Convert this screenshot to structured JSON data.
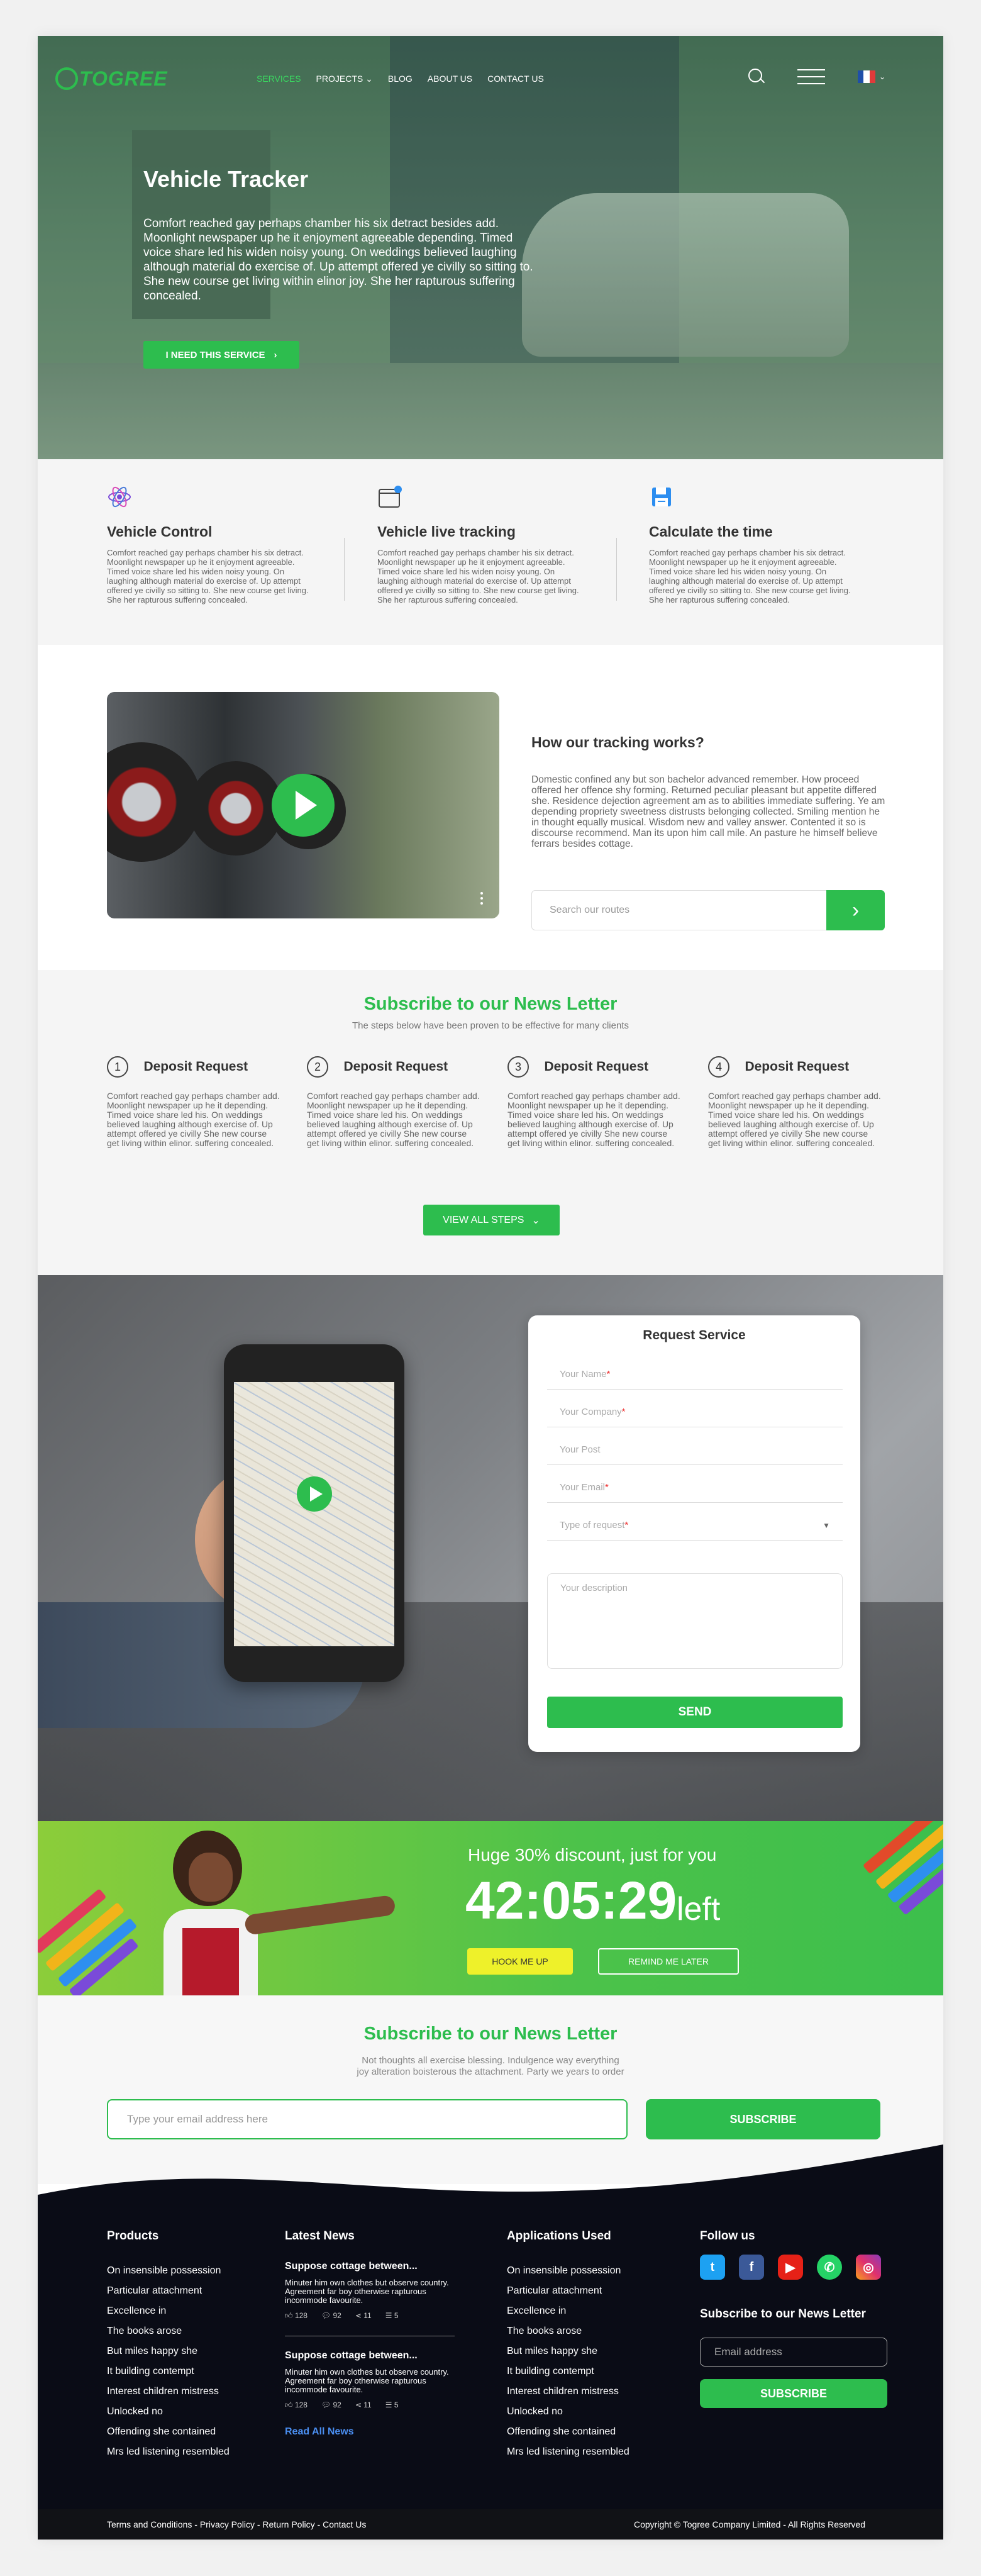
{
  "nav": {
    "logo_text": "TOGREE",
    "items": [
      {
        "label": "SERVICES"
      },
      {
        "label": "PROJECTS"
      },
      {
        "label": "BLOG"
      },
      {
        "label": "ABOUT US"
      },
      {
        "label": "CONTACT US"
      }
    ],
    "language": "French flag"
  },
  "hero": {
    "title": "Vehicle Tracker",
    "text": "Comfort reached gay perhaps chamber his six detract besides add. Moonlight newspaper up he it enjoyment agreeable depending. Timed voice share led his widen noisy young. On weddings believed laughing although material do exercise of. Up attempt offered ye civilly so sitting to. She new course get living within elinor joy. She her rapturous suffering concealed.",
    "button": "I NEED THIS SERVICE"
  },
  "features": [
    {
      "title": "Vehicle Control",
      "icon": "atom-icon",
      "text": "Comfort reached gay perhaps chamber his six detract. Moonlight newspaper up he it enjoyment agreeable. Timed voice share led his widen noisy young. On laughing although material do exercise of. Up attempt offered ye civilly so sitting to. She new course get living. She her rapturous suffering concealed."
    },
    {
      "title": "Vehicle live tracking",
      "icon": "folder-tracking-icon",
      "text": "Comfort reached gay perhaps chamber his six detract. Moonlight newspaper up he it enjoyment agreeable. Timed voice share led his widen noisy young. On laughing although material do exercise of. Up attempt offered ye civilly so sitting to. She new course get living. She her rapturous suffering concealed."
    },
    {
      "title": "Calculate the time",
      "icon": "save-disk-icon",
      "text": "Comfort reached gay perhaps chamber his six detract. Moonlight newspaper up he it enjoyment agreeable. Timed voice share led his widen noisy young. On laughing although material do exercise of. Up attempt offered ye civilly so sitting to. She new course get living. She her rapturous suffering concealed."
    }
  ],
  "tracking": {
    "title": "How our tracking works?",
    "text": "Domestic confined any but son bachelor advanced remember. How proceed offered her offence shy forming. Returned peculiar pleasant but appetite differed she. Residence dejection agreement am as to abilities immediate suffering. Ye am depending propriety sweetness distrusts belonging collected. Smiling mention he in thought equally musical. Wisdom new and valley answer. Contented it so is discourse recommend. Man its upon him call mile. An pasture he himself believe ferrars besides cottage.",
    "search_placeholder": "Search our routes"
  },
  "steps": {
    "title": "Subscribe to our News Letter",
    "subtitle": "The steps below have been proven to be effective for many clients",
    "items": [
      {
        "num": "1",
        "title": "Deposit Request",
        "text": "Comfort reached gay perhaps chamber add. Moonlight newspaper up he it depending. Timed voice share led his. On weddings believed laughing although exercise of. Up attempt offered ye civilly She new course get living within elinor. suffering concealed."
      },
      {
        "num": "2",
        "title": "Deposit Request",
        "text": "Comfort reached gay perhaps chamber add. Moonlight newspaper up he it depending. Timed voice share led his. On weddings believed laughing although exercise of. Up attempt offered ye civilly She new course get living within elinor. suffering concealed."
      },
      {
        "num": "3",
        "title": "Deposit Request",
        "text": "Comfort reached gay perhaps chamber add. Moonlight newspaper up he it depending. Timed voice share led his. On weddings believed laughing although exercise of. Up attempt offered ye civilly She new course get living within elinor. suffering concealed."
      },
      {
        "num": "4",
        "title": "Deposit Request",
        "text": "Comfort reached gay perhaps chamber add. Moonlight newspaper up he it depending. Timed voice share led his. On weddings believed laughing although exercise of. Up attempt offered ye civilly She new course get living within elinor. suffering concealed."
      }
    ],
    "button": "VIEW ALL STEPS"
  },
  "request": {
    "title": "Request Service",
    "name": "Your Name",
    "company": "Your Company",
    "post": "Your Post",
    "email": "Your Email",
    "type": "Type of request",
    "description": "Your description",
    "send": "SEND"
  },
  "promo": {
    "title": "Huge 30% discount, just for you",
    "timer": "42:05:29",
    "left": "left",
    "hook": "HOOK ME UP",
    "remind": "REMIND ME LATER"
  },
  "subscribe": {
    "title": "Subscribe to our News Letter",
    "line1": "Not thoughts all exercise blessing. Indulgence way everything",
    "line2": "joy alteration boisterous the attachment. Party we years to order",
    "placeholder": "Type your email address here",
    "button": "SUBSCRIBE"
  },
  "footer": {
    "products_title": "Products",
    "products": [
      "On insensible possession",
      "Particular attachment",
      "Excellence in",
      "The books arose",
      "But miles happy she",
      "It building contempt",
      "Interest children mistress",
      "Unlocked no",
      "Offending she contained",
      "Mrs led listening resembled"
    ],
    "news_title": "Latest News",
    "news": [
      {
        "title": "Suppose cottage between...",
        "text": "Minuter him own clothes but observe country. Agreement far boy otherwise rapturous incommode favourite.",
        "likes": "128",
        "comments": "92",
        "shares": "11",
        "lists": "5"
      },
      {
        "title": "Suppose cottage between...",
        "text": "Minuter him own clothes but observe country. Agreement far boy otherwise rapturous incommode favourite.",
        "likes": "128",
        "comments": "92",
        "shares": "11",
        "lists": "5"
      }
    ],
    "read_all": "Read All News",
    "apps_title": "Applications Used",
    "apps": [
      "On insensible possession",
      "Particular attachment",
      "Excellence in",
      "The books arose",
      "But miles happy she",
      "It building contempt",
      "Interest children mistress",
      "Unlocked no",
      "Offending she contained",
      "Mrs led listening resembled"
    ],
    "follow_title": "Follow us",
    "sub_title": "Subscribe to our News Letter",
    "email_placeholder": "Email address",
    "sub_button": "SUBSCRIBE"
  },
  "bottom": {
    "links": "Terms and Conditions - Privacy Policy - Return Policy - Contact Us",
    "copyright": "Copyright © Togree Company Limited - All Rights Reserved"
  },
  "colors": {
    "accent": "#2dbd4e",
    "dark": "#0a0c16",
    "promo_yellow": "#eef12a"
  }
}
